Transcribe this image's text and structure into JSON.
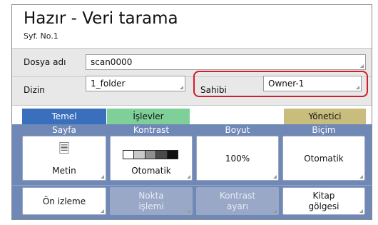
{
  "header": {
    "title": "Hazır - Veri tarama",
    "page_label": "Syf. No.1"
  },
  "fields": {
    "filename": {
      "label": "Dosya adı",
      "value": "scan0000"
    },
    "directory": {
      "label": "Dizin",
      "value": "1_folder"
    },
    "owner": {
      "label": "Sahibi",
      "value": "Owner-1"
    }
  },
  "tabs": {
    "basic": "Temel",
    "functions": "İşlevler",
    "admin": "Yönetici"
  },
  "columns": {
    "page": "Sayfa",
    "contrast": "Kontrast",
    "size": "Boyut",
    "format": "Biçim"
  },
  "buttons": {
    "page": "Metin",
    "contrast": "Otomatik",
    "size": "100%",
    "format": "Otomatik",
    "preview": "Ön izleme",
    "dot_line1": "Nokta",
    "dot_line2": "işlemi",
    "contrast_adj_line1": "Kontrast",
    "contrast_adj_line2": "ayarı",
    "book_line1": "Kitap",
    "book_line2": "gölgesi"
  },
  "colors": {
    "tab_basic": "#3a6fbe",
    "tab_functions": "#7fcf99",
    "tab_admin": "#c8bd7d",
    "panel": "#6f88b6",
    "highlight": "#d01e2a"
  },
  "icons": {
    "page_type": "document-icon",
    "contrast_scale": "contrast-scale-icon"
  }
}
